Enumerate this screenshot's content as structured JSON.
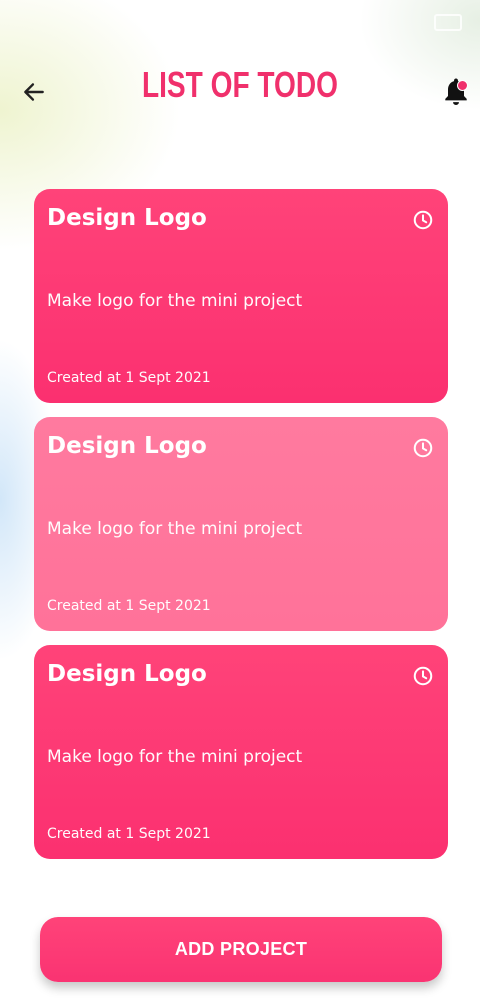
{
  "header": {
    "title": "LIST OF TODO",
    "back_icon": "arrow-left-icon",
    "notification_icon": "bell-icon",
    "accent_color": "#f0306c"
  },
  "todos": [
    {
      "title": "Design Logo",
      "description": "Make logo for the mini project",
      "created": "Created at 1 Sept 2021",
      "icon": "clock-icon"
    },
    {
      "title": "Design Logo",
      "description": "Make logo for the mini project",
      "created": "Created at 1 Sept 2021",
      "icon": "clock-icon"
    },
    {
      "title": "Design Logo",
      "description": "Make logo for the mini project",
      "created": "Created at 1 Sept 2021",
      "icon": "clock-icon"
    }
  ],
  "footer": {
    "add_label": "ADD PROJECT"
  }
}
